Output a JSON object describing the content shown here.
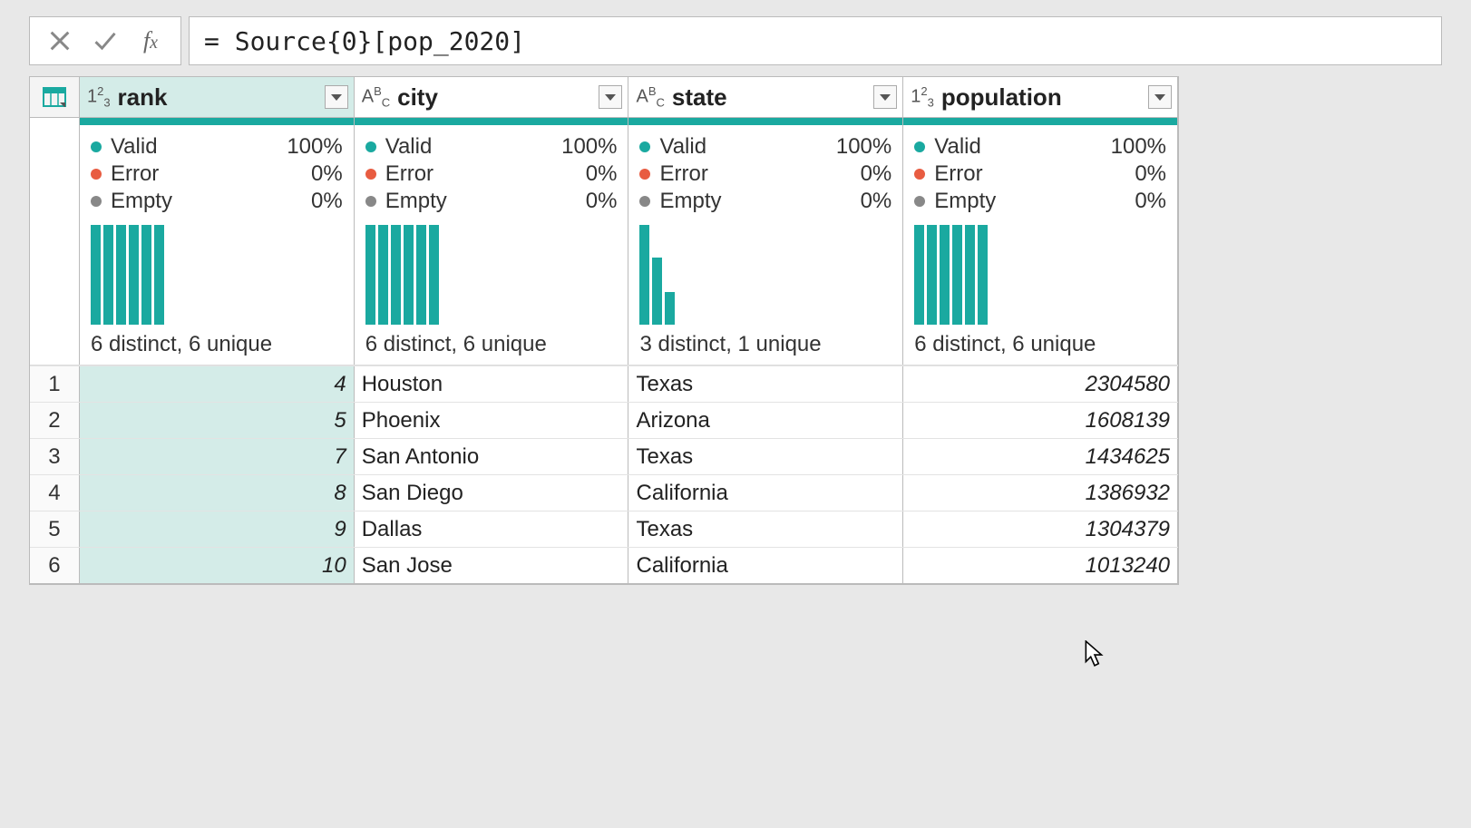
{
  "formula": "= Source{0}[pop_2020]",
  "columns": [
    {
      "name": "rank",
      "type": "number",
      "quality": {
        "valid": "100%",
        "error": "0%",
        "empty": "0%"
      },
      "distinct": "6 distinct, 6 unique",
      "bars": [
        100,
        100,
        100,
        100,
        100,
        100
      ],
      "selected": true
    },
    {
      "name": "city",
      "type": "text",
      "quality": {
        "valid": "100%",
        "error": "0%",
        "empty": "0%"
      },
      "distinct": "6 distinct, 6 unique",
      "bars": [
        100,
        100,
        100,
        100,
        100,
        100
      ],
      "selected": false
    },
    {
      "name": "state",
      "type": "text",
      "quality": {
        "valid": "100%",
        "error": "0%",
        "empty": "0%"
      },
      "distinct": "3 distinct, 1 unique",
      "bars": [
        100,
        67,
        33
      ],
      "selected": false
    },
    {
      "name": "population",
      "type": "number",
      "quality": {
        "valid": "100%",
        "error": "0%",
        "empty": "0%"
      },
      "distinct": "6 distinct, 6 unique",
      "bars": [
        100,
        100,
        100,
        100,
        100,
        100
      ],
      "selected": false
    }
  ],
  "labels": {
    "valid": "Valid",
    "error": "Error",
    "empty": "Empty"
  },
  "rows": [
    {
      "n": "1",
      "rank": "4",
      "city": "Houston",
      "state": "Texas",
      "population": "2304580"
    },
    {
      "n": "2",
      "rank": "5",
      "city": "Phoenix",
      "state": "Arizona",
      "population": "1608139"
    },
    {
      "n": "3",
      "rank": "7",
      "city": "San Antonio",
      "state": "Texas",
      "population": "1434625"
    },
    {
      "n": "4",
      "rank": "8",
      "city": "San Diego",
      "state": "California",
      "population": "1386932"
    },
    {
      "n": "5",
      "rank": "9",
      "city": "Dallas",
      "state": "Texas",
      "population": "1304379"
    },
    {
      "n": "6",
      "rank": "10",
      "city": "San Jose",
      "state": "California",
      "population": "1013240"
    }
  ],
  "chart_data": {
    "type": "table",
    "title": "Source{0}[pop_2020] preview",
    "columns": [
      "rank",
      "city",
      "state",
      "population"
    ],
    "rows": [
      [
        4,
        "Houston",
        "Texas",
        2304580
      ],
      [
        5,
        "Phoenix",
        "Arizona",
        1608139
      ],
      [
        7,
        "San Antonio",
        "Texas",
        1434625
      ],
      [
        8,
        "San Diego",
        "California",
        1386932
      ],
      [
        9,
        "Dallas",
        "Texas",
        1304379
      ],
      [
        10,
        "San Jose",
        "California",
        1013240
      ]
    ],
    "column_profiles": {
      "rank": {
        "distinct": 6,
        "unique": 6
      },
      "city": {
        "distinct": 6,
        "unique": 6
      },
      "state": {
        "distinct": 3,
        "unique": 1
      },
      "population": {
        "distinct": 6,
        "unique": 6
      }
    }
  }
}
